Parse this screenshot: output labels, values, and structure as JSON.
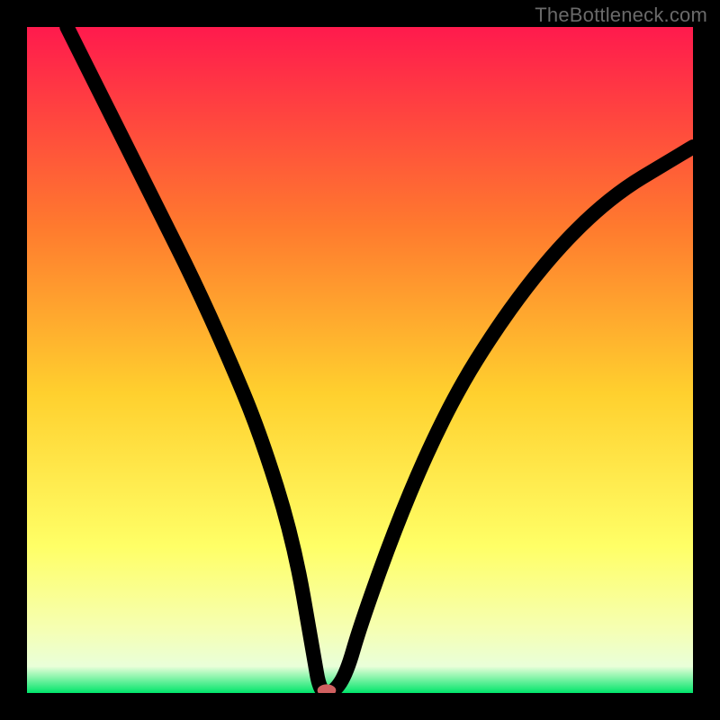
{
  "watermark": "TheBottleneck.com",
  "colors": {
    "bg_black": "#000000",
    "gradient_top": "#ff1a4d",
    "gradient_mid1": "#ff7a2e",
    "gradient_mid2": "#ffd02e",
    "gradient_mid3": "#ffff66",
    "gradient_mid4": "#f6ffb0",
    "gradient_bottom_band": "#e9ffd9",
    "gradient_green": "#00e56a",
    "curve_stroke": "#000000",
    "marker_fill": "#d06060"
  },
  "chart_data": {
    "type": "line",
    "title": "",
    "xlabel": "",
    "ylabel": "",
    "xlim": [
      0,
      100
    ],
    "ylim": [
      0,
      100
    ],
    "grid": false,
    "legend": false,
    "annotations": [
      "TheBottleneck.com"
    ],
    "series": [
      {
        "name": "bottleneck-curve",
        "x": [
          6,
          10,
          15,
          20,
          25,
          30,
          35,
          40,
          43,
          44,
          46,
          48,
          50,
          55,
          60,
          65,
          70,
          75,
          80,
          85,
          90,
          95,
          100
        ],
        "y": [
          100,
          92,
          82,
          72,
          62,
          51,
          39,
          23,
          6,
          0,
          0,
          3,
          10,
          24,
          36,
          46,
          54,
          61,
          67,
          72,
          76,
          79,
          82
        ]
      }
    ],
    "flat_bottom_range_x": [
      44,
      46
    ],
    "marker": {
      "x": 45,
      "y": 0.4,
      "rx": 1.4,
      "ry": 0.9
    }
  }
}
